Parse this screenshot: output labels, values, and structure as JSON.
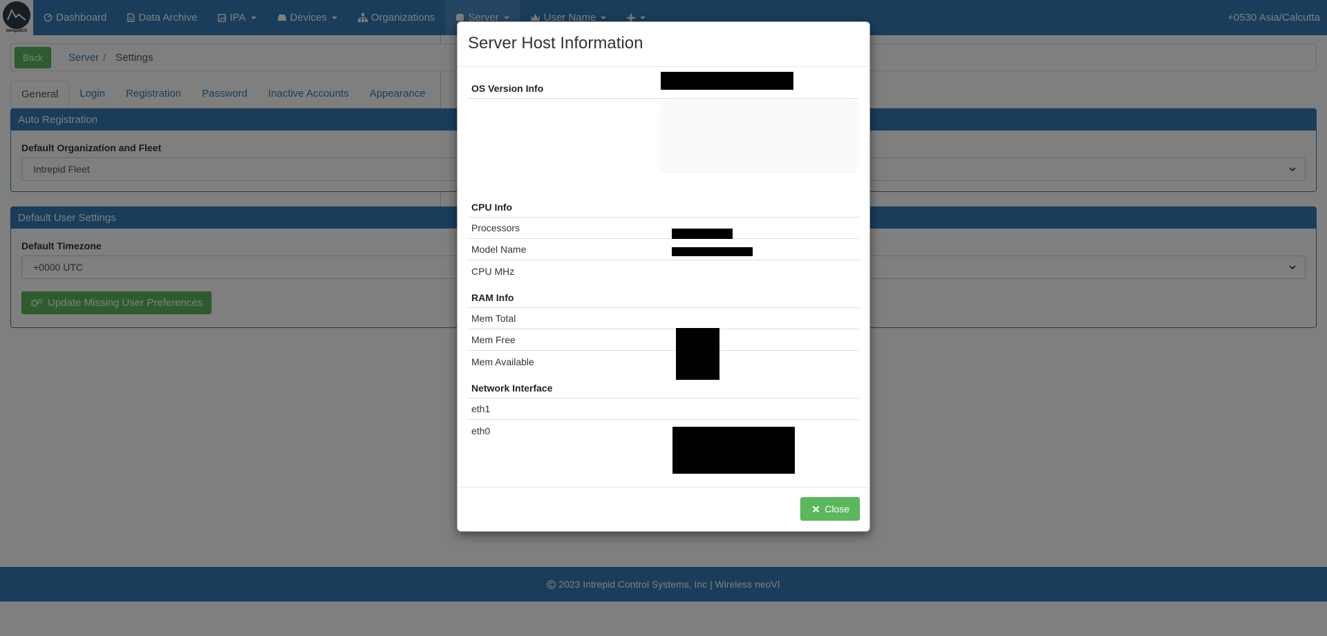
{
  "brand": {
    "logo_icon": "intrepidcs-logo-icon",
    "text": "IntrepidCS"
  },
  "navbar": {
    "items": [
      {
        "label": "Dashboard",
        "icon": "dashboard-icon"
      },
      {
        "label": "Data Archive",
        "icon": "file-icon"
      },
      {
        "label": "IPA",
        "icon": "image-icon",
        "dropdown": true
      },
      {
        "label": "Devices",
        "icon": "hdd-icon",
        "dropdown": true
      },
      {
        "label": "Organizations",
        "icon": "tree-icon"
      },
      {
        "label": "Server",
        "icon": "server-icon",
        "dropdown": true,
        "active": true
      },
      {
        "label": "User Name",
        "icon": "crown-icon",
        "dropdown": true
      },
      {
        "label": "",
        "icon": "plus-icon",
        "dropdown": true
      }
    ],
    "timezone": "+0530 Asia/Calcutta"
  },
  "breadcrumb": {
    "back_label": "Back",
    "items": [
      "Server",
      "Settings"
    ],
    "separator": "/"
  },
  "tabs": [
    "General",
    "Login",
    "Registration",
    "Password",
    "Inactive Accounts",
    "Appearance"
  ],
  "auto_registration": {
    "heading": "Auto Registration",
    "label": "Default Organization and Fleet",
    "value": "Intrepid Fleet"
  },
  "default_user_settings": {
    "heading": "Default User Settings",
    "label": "Default Timezone",
    "value": "+0000 UTC",
    "button_label": "Update Missing User Preferences",
    "button_icon": "gears-icon"
  },
  "footer": {
    "icon": "copyright-icon",
    "text": "2023 Intrepid Control Systems, Inc | Wireless neoVI"
  },
  "modal": {
    "title": "Server Host Information",
    "os_section": "OS Version Info",
    "cpu_section": "CPU Info",
    "cpu_rows": [
      "Processors",
      "Model Name",
      "CPU MHz"
    ],
    "ram_section": "RAM Info",
    "ram_rows": [
      "Mem Total",
      "Mem Free",
      "Mem Available"
    ],
    "network_section": "Network Interface",
    "network_rows": [
      "eth1",
      "eth0"
    ],
    "close_label": "Close",
    "close_icon": "close-icon"
  },
  "colors": {
    "primary": "#337ab7",
    "success": "#5cb85c",
    "redaction": "#000000"
  }
}
